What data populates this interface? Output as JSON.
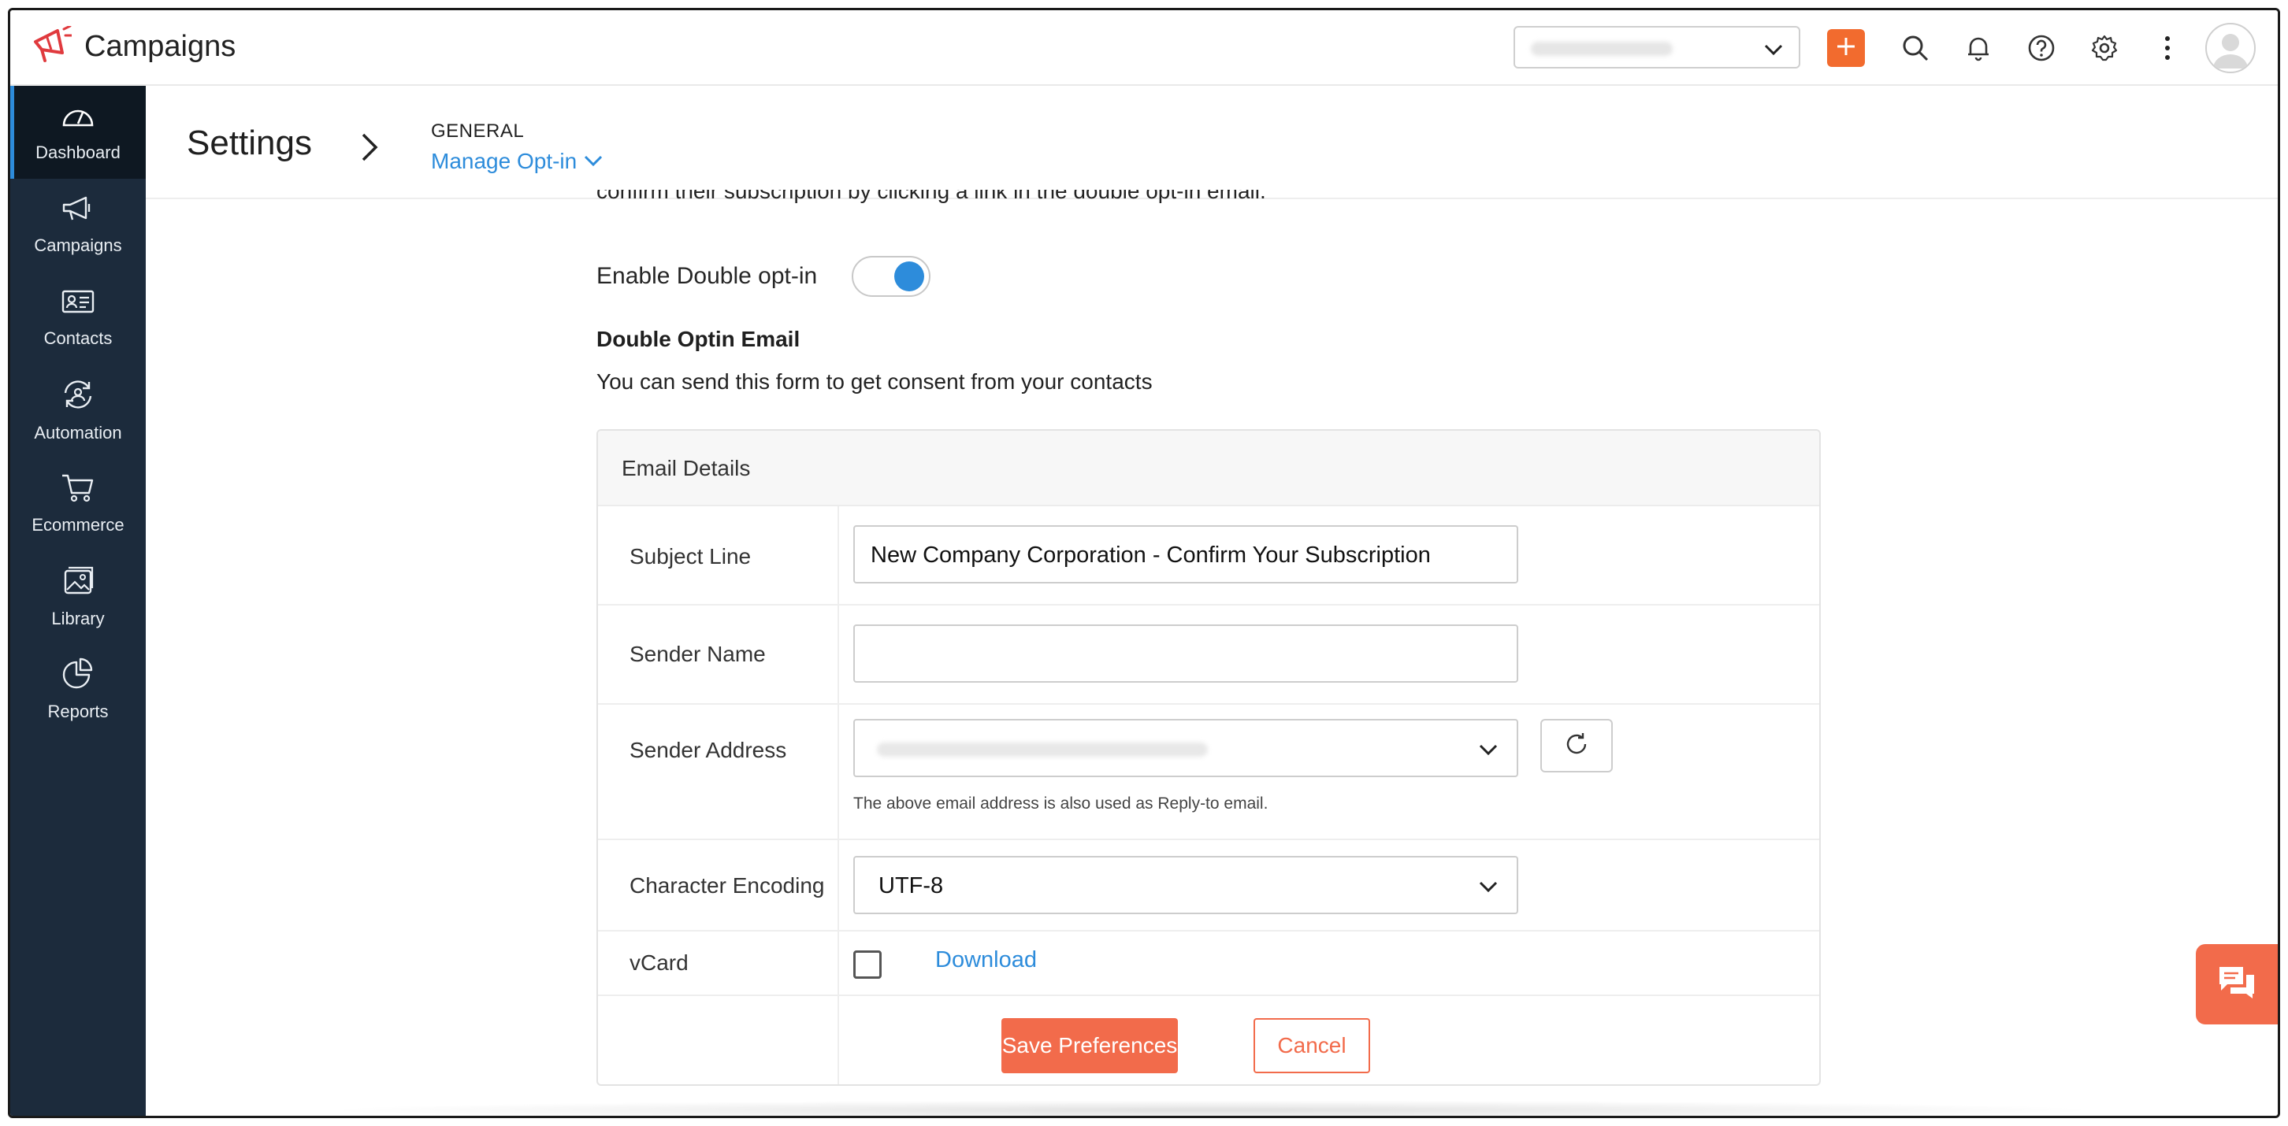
{
  "app": {
    "title": "Campaigns",
    "brand_color": "#e03a3e",
    "accent": "#f26b2e",
    "link_color": "#2d8cdb"
  },
  "topbar": {
    "org_select_value": "",
    "icons": [
      "plus-icon",
      "search-icon",
      "bell-icon",
      "help-icon",
      "gear-icon",
      "more-vertical-icon",
      "avatar"
    ]
  },
  "sidebar": {
    "items": [
      {
        "label": "Dashboard",
        "icon": "gauge-icon",
        "active": true
      },
      {
        "label": "Campaigns",
        "icon": "megaphone-icon",
        "active": false
      },
      {
        "label": "Contacts",
        "icon": "contact-card-icon",
        "active": false
      },
      {
        "label": "Automation",
        "icon": "automation-icon",
        "active": false
      },
      {
        "label": "Ecommerce",
        "icon": "cart-icon",
        "active": false
      },
      {
        "label": "Library",
        "icon": "images-icon",
        "active": false
      },
      {
        "label": "Reports",
        "icon": "pie-chart-icon",
        "active": false
      }
    ]
  },
  "header": {
    "title": "Settings",
    "breadcrumb_section": "GENERAL",
    "breadcrumb_page": "Manage Opt-in"
  },
  "content": {
    "partial_text": "confirm their subscription by clicking a link in the double opt-in email.",
    "double_optin_label": "Enable Double opt-in",
    "double_optin_enabled": true,
    "section_title": "Double Optin Email",
    "section_desc": "You can send this form to get consent from your contacts",
    "card_title": "Email Details",
    "subject_label": "Subject Line",
    "subject_value": "New Company Corporation - Confirm Your Subscription",
    "sender_name_label": "Sender Name",
    "sender_name_value": "",
    "sender_address_label": "Sender Address",
    "sender_address_value": "",
    "sender_hint": "The above email address is also used as Reply-to email.",
    "encoding_label": "Character Encoding",
    "encoding_value": "UTF-8",
    "vcard_label": "vCard",
    "vcard_checked": false,
    "download_label": "Download",
    "save_label": "Save Preferences",
    "cancel_label": "Cancel"
  }
}
